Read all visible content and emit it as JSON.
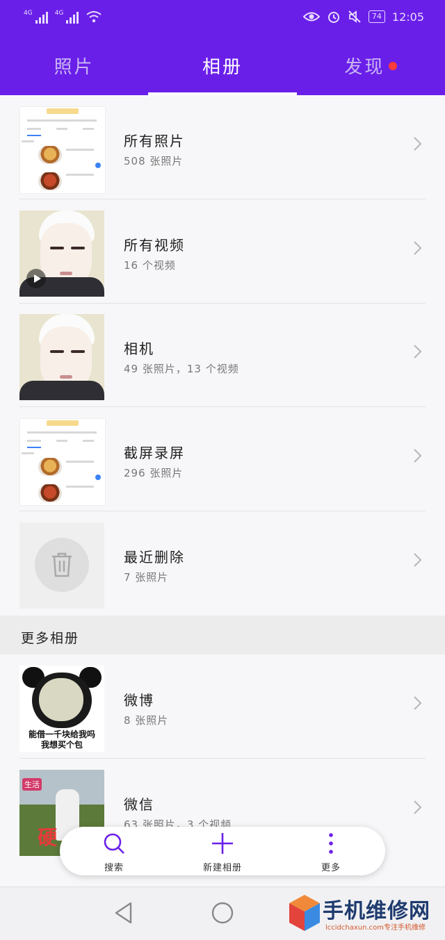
{
  "status_bar": {
    "network_left": "4G",
    "network_right": "4G",
    "battery": "74",
    "time": "12:05"
  },
  "tabs": [
    {
      "label": "照片",
      "active": false
    },
    {
      "label": "相册",
      "active": true
    },
    {
      "label": "发现",
      "active": false,
      "badge": true
    }
  ],
  "albums": [
    {
      "title": "所有照片",
      "subtitle": "508 张照片"
    },
    {
      "title": "所有视频",
      "subtitle": "16 个视频"
    },
    {
      "title": "相机",
      "subtitle": "49 张照片，13 个视频"
    },
    {
      "title": "截屏录屏",
      "subtitle": "296 张照片"
    },
    {
      "title": "最近删除",
      "subtitle": "7 张照片"
    }
  ],
  "more_section": {
    "title": "更多相册",
    "albums": [
      {
        "title": "微博",
        "subtitle": "8 张照片",
        "thumb_caption_1": "能借一千块给我吗",
        "thumb_caption_2": "我想买个包"
      },
      {
        "title": "微信",
        "subtitle": "63 张照片，3 个视频",
        "thumb_tag": "生活",
        "thumb_text": "硬"
      }
    ]
  },
  "floating_bar": {
    "search_label": "搜索",
    "new_album_label": "新建相册",
    "more_label": "更多"
  },
  "watermark": {
    "title": "手机维修网",
    "url": "lccidchaxun.com专注手机维修"
  },
  "colors": {
    "header": "#6a1fe9",
    "accent": "#6a1fe9",
    "badge": "#ff3b3b"
  }
}
